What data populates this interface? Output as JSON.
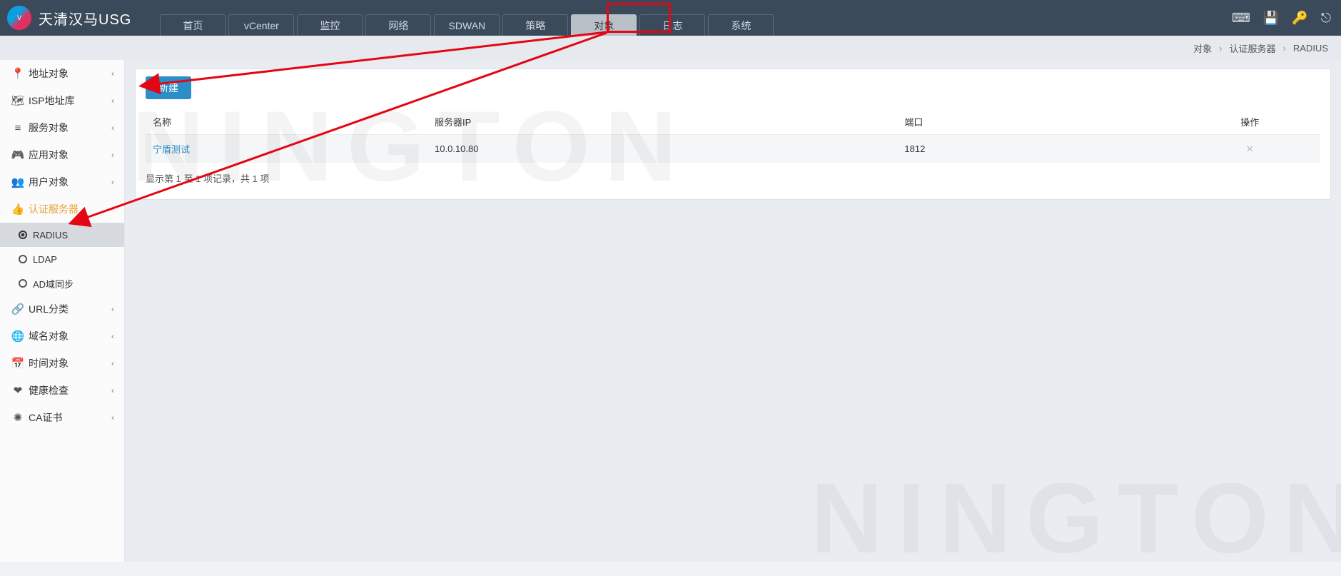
{
  "header": {
    "product_name": "天清汉马USG",
    "nav": [
      "首页",
      "vCenter",
      "监控",
      "网络",
      "SDWAN",
      "策略",
      "对象",
      "日志",
      "系统"
    ],
    "active_nav_index": 6
  },
  "breadcrumb": {
    "a": "对象",
    "b": "认证服务器",
    "c": "RADIUS"
  },
  "sidebar": {
    "items": [
      {
        "icon": "📍",
        "label": "地址对象"
      },
      {
        "icon": "🗺",
        "label": "ISP地址库"
      },
      {
        "icon": "≡",
        "label": "服务对象"
      },
      {
        "icon": "🎮",
        "label": "应用对象"
      },
      {
        "icon": "👥",
        "label": "用户对象"
      },
      {
        "icon": "👍",
        "label": "认证服务器",
        "auth": true
      },
      {
        "icon": "🔗",
        "label": "URL分类"
      },
      {
        "icon": "🌐",
        "label": "域名对象"
      },
      {
        "icon": "📅",
        "label": "时间对象"
      },
      {
        "icon": "❤",
        "label": "健康检查"
      },
      {
        "icon": "✺",
        "label": "CA证书"
      }
    ],
    "auth_sub": [
      "RADIUS",
      "LDAP",
      "AD域同步"
    ],
    "auth_sub_active": 0
  },
  "content": {
    "new_button": "新建",
    "table": {
      "headers": {
        "name": "名称",
        "ip": "服务器IP",
        "port": "端口",
        "op": "操作"
      },
      "rows": [
        {
          "name": "宁盾测试",
          "ip": "10.0.10.80",
          "port": "1812"
        }
      ]
    },
    "pager_text": "显示第 1 至 1 项记录，共 1 项"
  },
  "watermark": "NINGTON"
}
